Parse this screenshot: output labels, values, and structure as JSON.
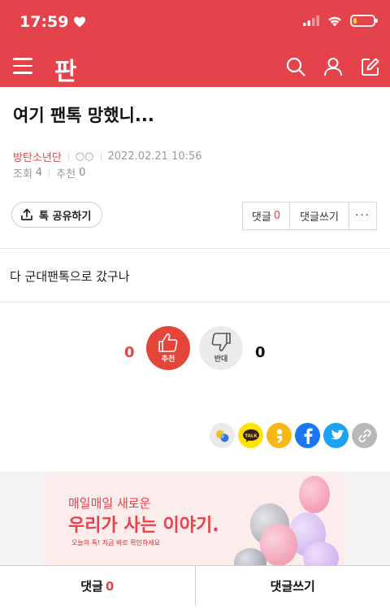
{
  "status_bar": {
    "time": "17:59"
  },
  "nav": {
    "logo": "판"
  },
  "post": {
    "title": "여기 팬톡 망했니...",
    "author": "방탄소년단",
    "nickname": "○○",
    "date": "2022.02.21 10:56",
    "views_label": "조회",
    "views": "4",
    "recommend_label": "추천",
    "recommend": "0",
    "body": "다 군대팬톡으로 갔구나"
  },
  "actions": {
    "share_label": "톡 공유하기",
    "comment_label": "댓글",
    "comment_count": "0",
    "write_comment_label": "댓글쓰기",
    "more_label": "···"
  },
  "votes": {
    "up_count": "0",
    "up_label": "추천",
    "down_label": "반대",
    "down_count": "0"
  },
  "share_icons": [
    "band-icon",
    "kakaotalk-icon",
    "kakaostory-icon",
    "facebook-icon",
    "twitter-icon",
    "link-icon"
  ],
  "banner": {
    "subtitle": "매일매일 새로운",
    "title": "우리가 사는 이야기.",
    "small": "오늘의 톡! 지금 바로 확인하세요"
  },
  "bottom_bar": {
    "comment_label": "댓글",
    "comment_count": "0",
    "write_label": "댓글쓰기"
  },
  "colors": {
    "brand": "#e4434c",
    "battery": "#ffc93d"
  }
}
